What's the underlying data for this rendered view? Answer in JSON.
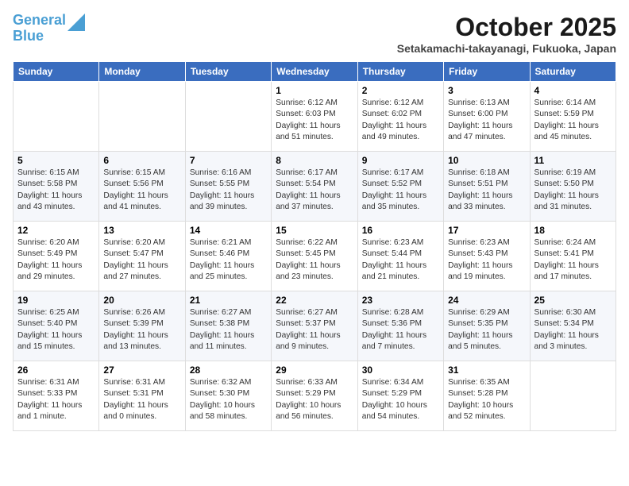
{
  "logo": {
    "line1": "General",
    "line2": "Blue"
  },
  "title": "October 2025",
  "subtitle": "Setakamachi-takayanagi, Fukuoka, Japan",
  "weekdays": [
    "Sunday",
    "Monday",
    "Tuesday",
    "Wednesday",
    "Thursday",
    "Friday",
    "Saturday"
  ],
  "weeks": [
    [
      {
        "day": "",
        "info": ""
      },
      {
        "day": "",
        "info": ""
      },
      {
        "day": "",
        "info": ""
      },
      {
        "day": "1",
        "info": "Sunrise: 6:12 AM\nSunset: 6:03 PM\nDaylight: 11 hours\nand 51 minutes."
      },
      {
        "day": "2",
        "info": "Sunrise: 6:12 AM\nSunset: 6:02 PM\nDaylight: 11 hours\nand 49 minutes."
      },
      {
        "day": "3",
        "info": "Sunrise: 6:13 AM\nSunset: 6:00 PM\nDaylight: 11 hours\nand 47 minutes."
      },
      {
        "day": "4",
        "info": "Sunrise: 6:14 AM\nSunset: 5:59 PM\nDaylight: 11 hours\nand 45 minutes."
      }
    ],
    [
      {
        "day": "5",
        "info": "Sunrise: 6:15 AM\nSunset: 5:58 PM\nDaylight: 11 hours\nand 43 minutes."
      },
      {
        "day": "6",
        "info": "Sunrise: 6:15 AM\nSunset: 5:56 PM\nDaylight: 11 hours\nand 41 minutes."
      },
      {
        "day": "7",
        "info": "Sunrise: 6:16 AM\nSunset: 5:55 PM\nDaylight: 11 hours\nand 39 minutes."
      },
      {
        "day": "8",
        "info": "Sunrise: 6:17 AM\nSunset: 5:54 PM\nDaylight: 11 hours\nand 37 minutes."
      },
      {
        "day": "9",
        "info": "Sunrise: 6:17 AM\nSunset: 5:52 PM\nDaylight: 11 hours\nand 35 minutes."
      },
      {
        "day": "10",
        "info": "Sunrise: 6:18 AM\nSunset: 5:51 PM\nDaylight: 11 hours\nand 33 minutes."
      },
      {
        "day": "11",
        "info": "Sunrise: 6:19 AM\nSunset: 5:50 PM\nDaylight: 11 hours\nand 31 minutes."
      }
    ],
    [
      {
        "day": "12",
        "info": "Sunrise: 6:20 AM\nSunset: 5:49 PM\nDaylight: 11 hours\nand 29 minutes."
      },
      {
        "day": "13",
        "info": "Sunrise: 6:20 AM\nSunset: 5:47 PM\nDaylight: 11 hours\nand 27 minutes."
      },
      {
        "day": "14",
        "info": "Sunrise: 6:21 AM\nSunset: 5:46 PM\nDaylight: 11 hours\nand 25 minutes."
      },
      {
        "day": "15",
        "info": "Sunrise: 6:22 AM\nSunset: 5:45 PM\nDaylight: 11 hours\nand 23 minutes."
      },
      {
        "day": "16",
        "info": "Sunrise: 6:23 AM\nSunset: 5:44 PM\nDaylight: 11 hours\nand 21 minutes."
      },
      {
        "day": "17",
        "info": "Sunrise: 6:23 AM\nSunset: 5:43 PM\nDaylight: 11 hours\nand 19 minutes."
      },
      {
        "day": "18",
        "info": "Sunrise: 6:24 AM\nSunset: 5:41 PM\nDaylight: 11 hours\nand 17 minutes."
      }
    ],
    [
      {
        "day": "19",
        "info": "Sunrise: 6:25 AM\nSunset: 5:40 PM\nDaylight: 11 hours\nand 15 minutes."
      },
      {
        "day": "20",
        "info": "Sunrise: 6:26 AM\nSunset: 5:39 PM\nDaylight: 11 hours\nand 13 minutes."
      },
      {
        "day": "21",
        "info": "Sunrise: 6:27 AM\nSunset: 5:38 PM\nDaylight: 11 hours\nand 11 minutes."
      },
      {
        "day": "22",
        "info": "Sunrise: 6:27 AM\nSunset: 5:37 PM\nDaylight: 11 hours\nand 9 minutes."
      },
      {
        "day": "23",
        "info": "Sunrise: 6:28 AM\nSunset: 5:36 PM\nDaylight: 11 hours\nand 7 minutes."
      },
      {
        "day": "24",
        "info": "Sunrise: 6:29 AM\nSunset: 5:35 PM\nDaylight: 11 hours\nand 5 minutes."
      },
      {
        "day": "25",
        "info": "Sunrise: 6:30 AM\nSunset: 5:34 PM\nDaylight: 11 hours\nand 3 minutes."
      }
    ],
    [
      {
        "day": "26",
        "info": "Sunrise: 6:31 AM\nSunset: 5:33 PM\nDaylight: 11 hours\nand 1 minute."
      },
      {
        "day": "27",
        "info": "Sunrise: 6:31 AM\nSunset: 5:31 PM\nDaylight: 11 hours\nand 0 minutes."
      },
      {
        "day": "28",
        "info": "Sunrise: 6:32 AM\nSunset: 5:30 PM\nDaylight: 10 hours\nand 58 minutes."
      },
      {
        "day": "29",
        "info": "Sunrise: 6:33 AM\nSunset: 5:29 PM\nDaylight: 10 hours\nand 56 minutes."
      },
      {
        "day": "30",
        "info": "Sunrise: 6:34 AM\nSunset: 5:29 PM\nDaylight: 10 hours\nand 54 minutes."
      },
      {
        "day": "31",
        "info": "Sunrise: 6:35 AM\nSunset: 5:28 PM\nDaylight: 10 hours\nand 52 minutes."
      },
      {
        "day": "",
        "info": ""
      }
    ]
  ]
}
